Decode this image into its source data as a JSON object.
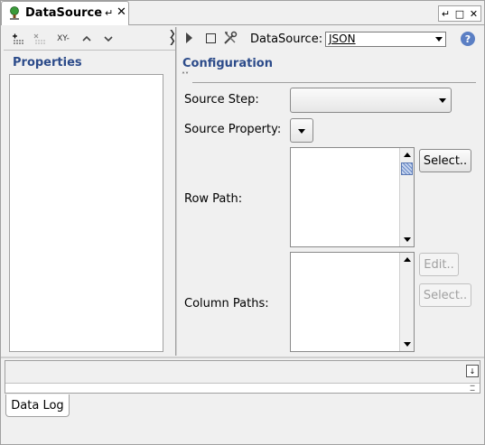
{
  "window": {
    "tab_title": "DataSource",
    "tab_icon": "datasource-tree-icon",
    "controls": [
      "minimize-icon",
      "maximize-icon",
      "close-icon"
    ]
  },
  "left_toolbar": {
    "icons": [
      "add-property-icon",
      "remove-property-icon",
      "xy-property-icon",
      "move-up-icon",
      "move-down-icon"
    ],
    "xy_label": "XY-"
  },
  "properties": {
    "title": "Properties"
  },
  "right_toolbar": {
    "datasource_label": "DataSource:",
    "datasource_value": "JSON"
  },
  "configuration": {
    "title": "Configuration",
    "fields": {
      "source_step_label": "Source Step:",
      "source_property_label": "Source Property:",
      "row_path_label": "Row Path:",
      "column_paths_label": "Column Paths:"
    },
    "buttons": {
      "select_row": "Select..",
      "edit_column": "Edit..",
      "select_column": "Select.."
    }
  },
  "bottom": {
    "data_log_tab": "Data Log"
  },
  "colors": {
    "section_title": "#2c4b8a",
    "help": "#5b7fc4"
  }
}
